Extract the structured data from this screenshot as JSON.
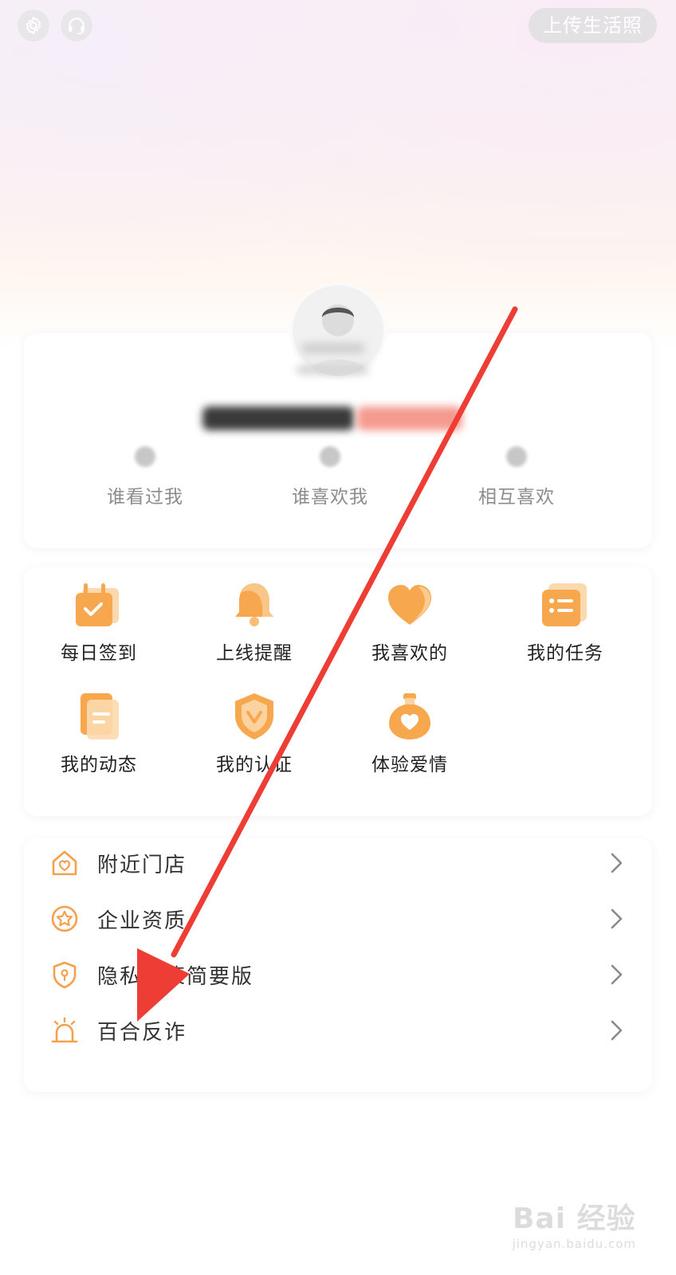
{
  "header": {
    "settings_icon": "gear-icon",
    "service_icon": "headset-icon",
    "upload_label": "上传生活照"
  },
  "profile": {
    "stats": [
      {
        "label": "谁看过我"
      },
      {
        "label": "谁喜欢我"
      },
      {
        "label": "相互喜欢"
      }
    ]
  },
  "features": [
    {
      "label": "每日签到",
      "icon": "calendar-check-icon"
    },
    {
      "label": "上线提醒",
      "icon": "bell-icon"
    },
    {
      "label": "我喜欢的",
      "icon": "heart-icon"
    },
    {
      "label": "我的任务",
      "icon": "task-list-icon"
    },
    {
      "label": "我的动态",
      "icon": "document-icon"
    },
    {
      "label": "我的认证",
      "icon": "shield-badge-icon"
    },
    {
      "label": "体验爱情",
      "icon": "love-bottle-icon"
    }
  ],
  "menu": [
    {
      "label": "附近门店",
      "icon": "store-heart-icon"
    },
    {
      "label": "企业资质",
      "icon": "star-circle-icon"
    },
    {
      "label": "隐私政策简要版",
      "icon": "privacy-shield-icon"
    },
    {
      "label": "百合反诈",
      "icon": "alarm-icon"
    }
  ],
  "colors": {
    "accent": "#f5a04a",
    "arrow": "#ee3d35",
    "muted_text": "#8c8c8c"
  },
  "watermark": {
    "logo": "Bai 经验",
    "url": "jingyan.baidu.com"
  }
}
